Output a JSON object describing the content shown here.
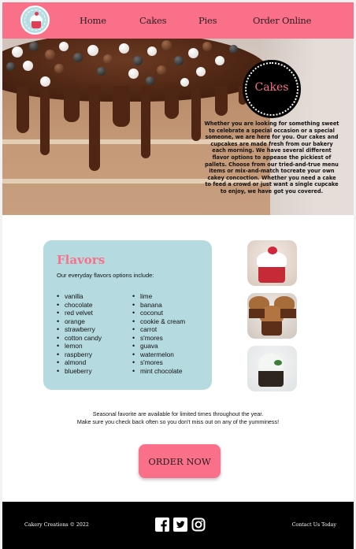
{
  "header": {
    "logo_icon": "cupcake-logo-icon",
    "nav": [
      "Home",
      "Cakes",
      "Pies",
      "Order Online"
    ]
  },
  "hero": {
    "badge": "Cakes",
    "text": "Whether you are looking for something sweet to celebrate a special occasion or a special someone, we are here for you. Our cakes and cupcakes are made fresh from our bakery each morning. We have several different flavor options to appease the pickiest of pallets. Choose from our tried-and-true menu items or mix-and-match tocreate your own cakey concoction. Whether you need a cake to feed a crowd or just want a single cupcake to enjoy, we have got you covered."
  },
  "flavors": {
    "title": "Flavors",
    "subtitle": "Our everyday flavors options include:",
    "col1": [
      "vanilla",
      "chocolate",
      "red velvet",
      "orange",
      "strawberry",
      "cotton candy",
      "lemon",
      "raspberry",
      "almond",
      "blueberry"
    ],
    "col2": [
      "lime",
      "banana",
      "coconut",
      "cookie & cream",
      "carrot",
      "s'mores",
      "guava",
      "watermelon",
      "s'mores",
      "mint chocolate"
    ]
  },
  "thumbnails": [
    "red-velvet-cupcake-image",
    "chocolate-cupcakes-image",
    "mint-cupcake-image"
  ],
  "seasonal": {
    "line1": "Seasonal favorite are available for limited times throughout the year.",
    "line2": "Make sure you check back often so you don't miss out on any of the yumminess!"
  },
  "order_button": "ORDER NOW",
  "footer": {
    "copyright": "Cakery Creations © 2022",
    "contact": "Contact Us Today",
    "social": [
      "facebook-icon",
      "twitter-icon",
      "instagram-icon"
    ]
  },
  "colors": {
    "accent_pink": "#fa7089",
    "card_blue": "#b5dbe0",
    "footer_black": "#000000"
  }
}
